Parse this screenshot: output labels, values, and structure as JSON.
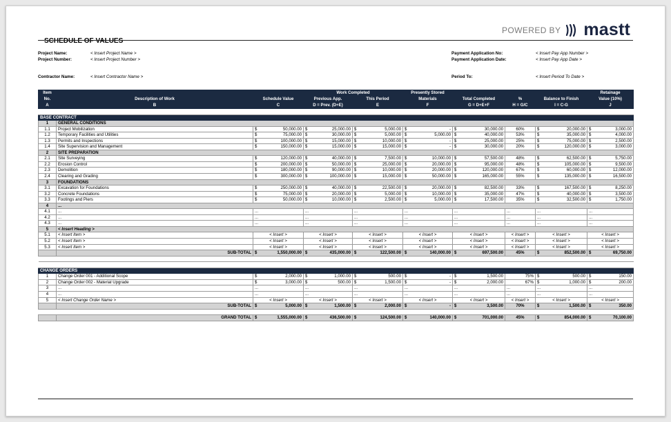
{
  "brand": {
    "powered_by": "POWERED BY",
    "name": "mastt"
  },
  "title": "SCHEDULE OF VALUES",
  "info": {
    "project_name_label": "Project Name:",
    "project_name": "< Insert Project Name >",
    "project_number_label": "Project Number:",
    "project_number": "< Insert Project Number >",
    "contractor_name_label": "Contractor Name:",
    "contractor_name": "< Insert Contractor Name >",
    "pay_app_no_label": "Payment Application No:",
    "pay_app_no": "< Insert Pay App Number >",
    "pay_app_date_label": "Payment Application Date:",
    "pay_app_date": "< Insert Pay App Date >",
    "period_to_label": "Period To:",
    "period_to": "< Insert Period To Date >"
  },
  "headers": {
    "item": "Item",
    "no": "No.",
    "desc": "Description of Work",
    "sched": "Schedule Value",
    "work_completed": "Work Completed",
    "prev_app": "Previous App.",
    "this_period": "This Period",
    "stored1": "Presently Stored",
    "stored2": "Materials",
    "total_completed": "Total Completed",
    "pct": "%",
    "balance": "Balance to Finish",
    "ret1": "Retainage",
    "ret2": "Value (10%)",
    "letters": [
      "A",
      "B",
      "C",
      "D = Prev. (D+E)",
      "E",
      "F",
      "G = D+E+F",
      "H = G/C",
      "I = C-G",
      "J"
    ]
  },
  "base_contract": {
    "label": "BASE CONTRACT",
    "groups": [
      {
        "no": "1",
        "heading": "GENERAL CONDITIONS",
        "rows": [
          {
            "no": "1.1",
            "desc": "Project Mobilization",
            "c": "50,000.00",
            "d": "25,000.00",
            "e": "5,000.00",
            "f": "-",
            "g": "30,000.00",
            "h": "60%",
            "i": "20,000.00",
            "j": "3,000.00"
          },
          {
            "no": "1.2",
            "desc": "Temporary Facilities and Utilities",
            "c": "75,000.00",
            "d": "30,000.00",
            "e": "5,000.00",
            "f": "5,000.00",
            "g": "40,000.00",
            "h": "53%",
            "i": "35,000.00",
            "j": "4,000.00"
          },
          {
            "no": "1.3",
            "desc": "Permits and Inspections",
            "c": "100,000.00",
            "d": "15,000.00",
            "e": "10,000.00",
            "f": "-",
            "g": "25,000.00",
            "h": "25%",
            "i": "75,000.00",
            "j": "2,500.00"
          },
          {
            "no": "1.4",
            "desc": "Site Supervision and Management",
            "c": "150,000.00",
            "d": "15,000.00",
            "e": "15,000.00",
            "f": "-",
            "g": "30,000.00",
            "h": "20%",
            "i": "120,000.00",
            "j": "3,000.00"
          }
        ]
      },
      {
        "no": "2",
        "heading": "SITE PREPARATION",
        "rows": [
          {
            "no": "2.1",
            "desc": "Site Surveying",
            "c": "120,000.00",
            "d": "40,000.00",
            "e": "7,500.00",
            "f": "10,000.00",
            "g": "57,500.00",
            "h": "48%",
            "i": "62,500.00",
            "j": "5,750.00"
          },
          {
            "no": "2.2",
            "desc": "Erosion Control",
            "c": "200,000.00",
            "d": "50,000.00",
            "e": "25,000.00",
            "f": "20,000.00",
            "g": "95,000.00",
            "h": "48%",
            "i": "105,000.00",
            "j": "9,500.00"
          },
          {
            "no": "2.3",
            "desc": "Demolition",
            "c": "180,000.00",
            "d": "90,000.00",
            "e": "10,000.00",
            "f": "20,000.00",
            "g": "120,000.00",
            "h": "67%",
            "i": "60,000.00",
            "j": "12,000.00"
          },
          {
            "no": "2.4",
            "desc": "Clearing and Grading",
            "c": "300,000.00",
            "d": "100,000.00",
            "e": "15,000.00",
            "f": "50,000.00",
            "g": "165,000.00",
            "h": "55%",
            "i": "135,000.00",
            "j": "16,500.00"
          }
        ]
      },
      {
        "no": "3",
        "heading": "FOUNDATIONS",
        "rows": [
          {
            "no": "3.1",
            "desc": "Excavation for Foundations",
            "c": "250,000.00",
            "d": "40,000.00",
            "e": "22,500.00",
            "f": "20,000.00",
            "g": "82,500.00",
            "h": "33%",
            "i": "167,500.00",
            "j": "8,250.00"
          },
          {
            "no": "3.2",
            "desc": "Concrete Foundations",
            "c": "75,000.00",
            "d": "20,000.00",
            "e": "5,000.00",
            "f": "10,000.00",
            "g": "35,000.00",
            "h": "47%",
            "i": "40,000.00",
            "j": "3,500.00"
          },
          {
            "no": "3.3",
            "desc": "Footings and Piers",
            "c": "50,000.00",
            "d": "10,000.00",
            "e": "2,500.00",
            "f": "5,000.00",
            "g": "17,500.00",
            "h": "35%",
            "i": "32,500.00",
            "j": "1,750.00"
          }
        ]
      },
      {
        "no": "4",
        "heading": "...",
        "ellipsis": true,
        "rows": [
          {
            "no": "4.1",
            "desc": "..."
          },
          {
            "no": "4.2",
            "desc": "..."
          },
          {
            "no": "4.3",
            "desc": "..."
          }
        ]
      },
      {
        "no": "5",
        "heading": "< Insert Heading >",
        "insert": true,
        "rows": [
          {
            "no": "5.1",
            "desc": "< Insert Item >"
          },
          {
            "no": "5.2",
            "desc": "< Insert Item >"
          },
          {
            "no": "5.3",
            "desc": "< Insert Item >"
          }
        ]
      }
    ],
    "subtotal": {
      "label": "SUB-TOTAL",
      "c": "1,550,000.00",
      "d": "435,000.00",
      "e": "122,500.00",
      "f": "140,000.00",
      "g": "697,500.00",
      "h": "45%",
      "i": "852,500.00",
      "j": "69,750.00"
    }
  },
  "change_orders": {
    "label": "CHANGE ORDERS",
    "rows": [
      {
        "no": "1",
        "desc": "Change Order 001 - Additional Scope",
        "c": "2,000.00",
        "d": "1,000.00",
        "e": "500.00",
        "f": "-",
        "g": "1,500.00",
        "h": "75%",
        "i": "500.00",
        "j": "150.00"
      },
      {
        "no": "2",
        "desc": "Change Order 002 - Material Upgrade",
        "c": "3,000.00",
        "d": "500.00",
        "e": "1,500.00",
        "f": "-",
        "g": "2,000.00",
        "h": "67%",
        "i": "1,000.00",
        "j": "200.00"
      },
      {
        "no": "3",
        "desc": "...",
        "ellipsis": true
      },
      {
        "no": "4",
        "desc": "...",
        "ellipsis": true
      },
      {
        "no": "5",
        "desc": "< Insert Change Order Name >",
        "insert": true
      }
    ],
    "subtotal": {
      "label": "SUB-TOTAL",
      "c": "5,000.00",
      "d": "1,500.00",
      "e": "2,000.00",
      "f": "-",
      "g": "3,500.00",
      "h": "70%",
      "i": "1,500.00",
      "j": "350.00"
    }
  },
  "grand_total": {
    "label": "GRAND TOTAL",
    "c": "1,555,000.00",
    "d": "436,500.00",
    "e": "124,500.00",
    "f": "140,000.00",
    "g": "701,000.00",
    "h": "45%",
    "i": "854,000.00",
    "j": "70,100.00"
  },
  "currency_symbol": "$",
  "ellipsis_text": "...",
  "insert_text": "< Insert >"
}
